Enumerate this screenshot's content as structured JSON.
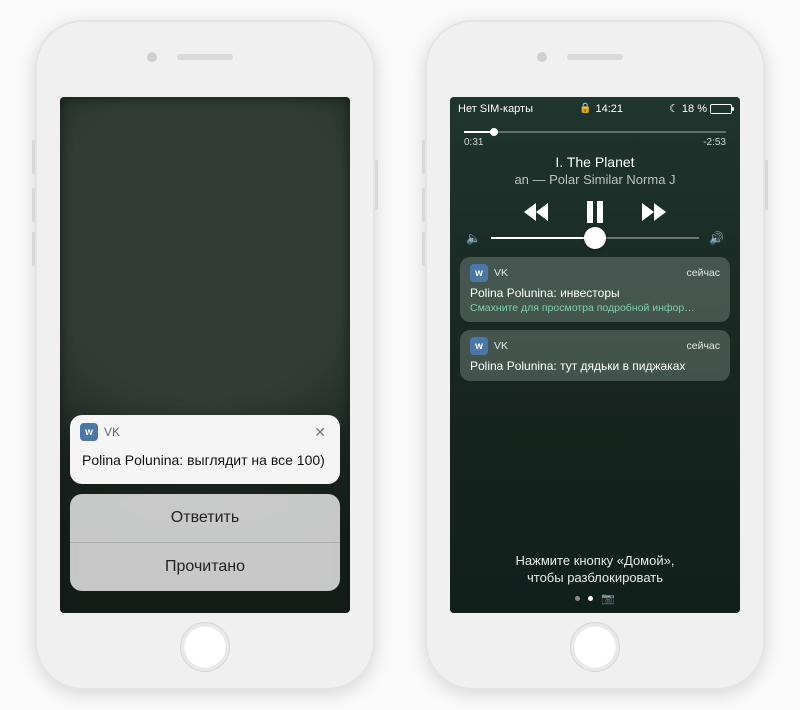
{
  "phone1": {
    "notification": {
      "app_name": "VK",
      "message": "Polina Polunina: выглядит на все 100)"
    },
    "actions": {
      "reply": "Ответить",
      "read": "Прочитано"
    }
  },
  "phone2": {
    "status": {
      "carrier": "Нет SIM-карты",
      "time": "14:21",
      "battery_pct": "18 %"
    },
    "player": {
      "elapsed": "0:31",
      "remaining": "-2:53",
      "title": "I. The Planet",
      "artist_line": "an — Polar Similar      Norma J"
    },
    "notifications": [
      {
        "app_name": "VK",
        "time": "сейчас",
        "body": "Polina Polunina: инвесторы",
        "hint": "Смахните для просмотра подробной инфор…"
      },
      {
        "app_name": "VK",
        "time": "сейчас",
        "body": "Polina Polunina: тут дядьки в пиджаках"
      }
    ],
    "unlock_hint_line1": "Нажмите кнопку «Домой»,",
    "unlock_hint_line2": "чтобы разблокировать"
  }
}
